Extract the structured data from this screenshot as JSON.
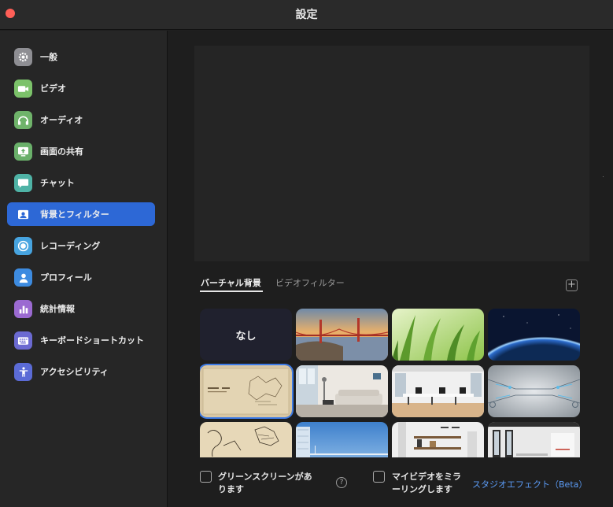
{
  "window": {
    "title": "設定"
  },
  "sidebar": {
    "items": [
      {
        "label": "一般",
        "icon": "gear-icon",
        "color": "#8e8e93"
      },
      {
        "label": "ビデオ",
        "icon": "video-camera-icon",
        "color": "#7cc26a"
      },
      {
        "label": "オーディオ",
        "icon": "headphones-icon",
        "color": "#6fb36a"
      },
      {
        "label": "画面の共有",
        "icon": "share-screen-icon",
        "color": "#6ab06a"
      },
      {
        "label": "チャット",
        "icon": "chat-bubble-icon",
        "color": "#4fb3a6"
      },
      {
        "label": "背景とフィルター",
        "icon": "background-portrait-icon",
        "color": "#2d68d6",
        "active": true
      },
      {
        "label": "レコーディング",
        "icon": "record-icon",
        "color": "#47a4e0"
      },
      {
        "label": "プロフィール",
        "icon": "profile-icon",
        "color": "#3d8be0"
      },
      {
        "label": "統計情報",
        "icon": "statistics-icon",
        "color": "#9b6ad1"
      },
      {
        "label": "キーボードショートカット",
        "icon": "keyboard-icon",
        "color": "#6b6ad1"
      },
      {
        "label": "アクセシビリティ",
        "icon": "accessibility-icon",
        "color": "#5b6bd6"
      }
    ]
  },
  "tabs": {
    "virtual_background": "バーチャル背景",
    "video_filter": "ビデオフィルター"
  },
  "backgrounds": {
    "none_label": "なし",
    "items": [
      "none",
      "golden-gate-bridge",
      "grass",
      "earth-from-space",
      "sketch-beige",
      "living-room",
      "office",
      "digital-network",
      "sketch-drawing",
      "glass-building",
      "shelves-interior",
      "modern-office"
    ]
  },
  "options": {
    "green_screen": "グリーンスクリーンがあります",
    "green_screen_line1": "グリーンスクリーンがあ",
    "green_screen_line2": "ります",
    "mirror_video_line1": "マイビデオをミラ",
    "mirror_video_line2": "ーリングします",
    "studio_effects": "スタジオエフェクト（Beta）"
  },
  "colors": {
    "accent": "#2d68d6",
    "link": "#5b9bf5",
    "close": "#ff5f57"
  }
}
